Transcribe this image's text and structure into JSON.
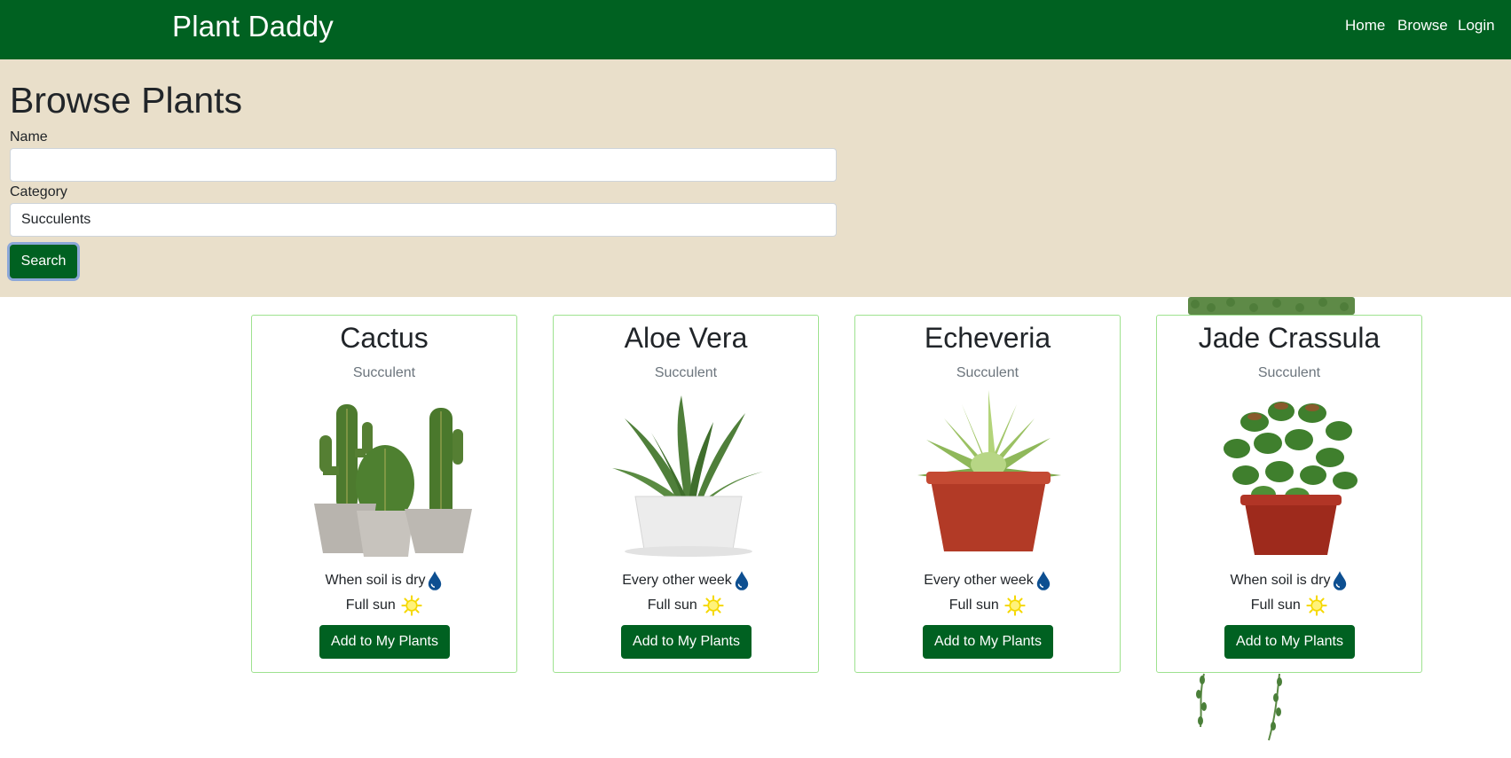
{
  "navbar": {
    "brand": "Plant Daddy",
    "links": [
      "Home",
      "Browse",
      "Login"
    ]
  },
  "search": {
    "title": "Browse Plants",
    "name_label": "Name",
    "name_value": "",
    "category_label": "Category",
    "category_value": "Succulents",
    "button_label": "Search"
  },
  "plants": [
    {
      "name": "Cactus",
      "category": "Succulent",
      "water": "When soil is dry",
      "light": "Full sun",
      "button": "Add to My Plants",
      "image": "cactus-trio-image"
    },
    {
      "name": "Aloe Vera",
      "category": "Succulent",
      "water": "Every other week",
      "light": "Full sun",
      "button": "Add to My Plants",
      "image": "aloe-vera-image"
    },
    {
      "name": "Echeveria",
      "category": "Succulent",
      "water": "Every other week",
      "light": "Full sun",
      "button": "Add to My Plants",
      "image": "echeveria-image"
    },
    {
      "name": "Jade Crassula",
      "category": "Succulent",
      "water": "When soil is dry",
      "light": "Full sun",
      "button": "Add to My Plants",
      "image": "jade-crassula-image"
    }
  ],
  "icons": {
    "water": "water-drop-icon",
    "light": "sun-icon"
  },
  "colors": {
    "brand_green": "#006121",
    "band_beige": "#e9dfca",
    "card_border": "#9ee28f",
    "drop_blue": "#0d4f91",
    "sun_yellow": "#f5d800"
  }
}
